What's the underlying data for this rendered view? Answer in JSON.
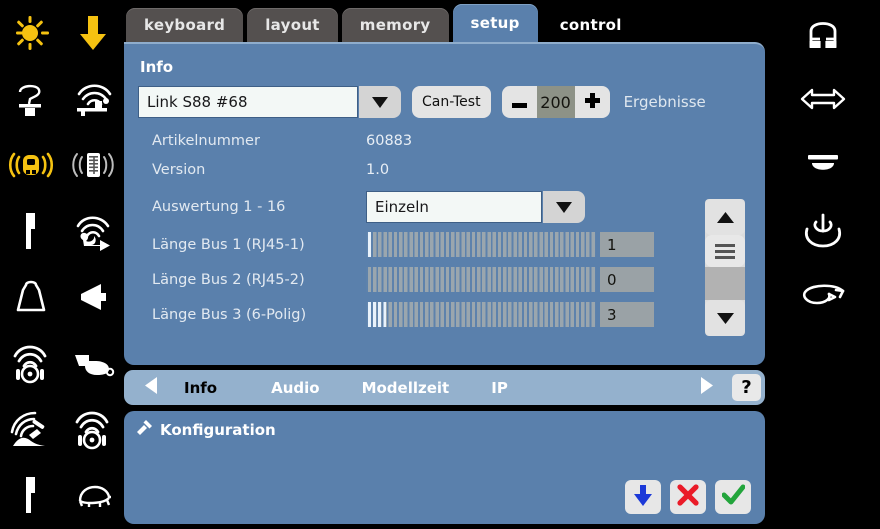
{
  "tabs": [
    {
      "label": "keyboard",
      "active": false
    },
    {
      "label": "layout",
      "active": false
    },
    {
      "label": "memory",
      "active": false
    },
    {
      "label": "setup",
      "active": true
    },
    {
      "label": "control",
      "active": false
    }
  ],
  "panel": {
    "title": "Info",
    "device_select": {
      "value": "Link S88 #68"
    },
    "can_test_label": "Can-Test",
    "stepper": {
      "minus": "–",
      "value": "200",
      "plus": "+"
    },
    "results_label": "Ergebnisse",
    "info_rows": [
      {
        "key": "Artikelnummer",
        "value": "60883"
      },
      {
        "key": "Version",
        "value": "1.0"
      }
    ],
    "auswertung": {
      "key": "Auswertung 1 - 16",
      "value": "Einzeln"
    },
    "bus_rows": [
      {
        "key": "Länge Bus 1 (RJ45-1)",
        "value": "1",
        "fill": 1,
        "segments": 44
      },
      {
        "key": "Länge Bus 2 (RJ45-2)",
        "value": "0",
        "fill": 0,
        "segments": 44
      },
      {
        "key": "Länge Bus 3 (6-Polig)",
        "value": "3",
        "fill": 4,
        "segments": 44
      }
    ]
  },
  "nav": {
    "prev_icon": "triangle-left-icon",
    "next_icon": "triangle-right-icon",
    "items": [
      {
        "label": "Info",
        "selected": true
      },
      {
        "label": "Audio",
        "selected": false
      },
      {
        "label": "Modellzeit",
        "selected": false
      },
      {
        "label": "IP",
        "selected": false
      }
    ],
    "help_label": "?"
  },
  "konfiguration": {
    "title": "Konfiguration",
    "icon": "wrench-icon",
    "actions": [
      {
        "name": "download-button",
        "icon": "down-arrow-icon",
        "color": "#1c39d8"
      },
      {
        "name": "cancel-button",
        "icon": "x-mark-icon",
        "color": "#ea1b28"
      },
      {
        "name": "confirm-button",
        "icon": "check-mark-icon",
        "color": "#23a53c"
      }
    ]
  },
  "sidebar_left": {
    "items": [
      {
        "name": "lamp-icon",
        "color": "#f5c211"
      },
      {
        "name": "down-arrow-icon",
        "color": "#f5c211"
      },
      {
        "name": "smoke-generator-icon",
        "color": "#ffffff"
      },
      {
        "name": "sound-horn-station-icon",
        "color": "#ffffff"
      },
      {
        "name": "locomotive-sound-icon",
        "color": "#f5c211"
      },
      {
        "name": "coach-sound-icon",
        "color": "#ffffff"
      },
      {
        "name": "signal-post-icon",
        "color": "#ffffff"
      },
      {
        "name": "fan-sound-icon",
        "color": "#ffffff"
      },
      {
        "name": "weight-icon",
        "color": "#ffffff"
      },
      {
        "name": "speaker-icon",
        "color": "#ffffff"
      },
      {
        "name": "siren-sound-icon",
        "color": "#ffffff"
      },
      {
        "name": "whistle-icon",
        "color": "#ffffff"
      },
      {
        "name": "coal-shovel-sound-icon",
        "color": "#ffffff"
      },
      {
        "name": "bell-sound-icon",
        "color": "#ffffff"
      },
      {
        "name": "signal-post-2-icon",
        "color": "#ffffff"
      },
      {
        "name": "turtle-slow-icon",
        "color": "#ffffff"
      }
    ]
  },
  "sidebar_right": {
    "items": [
      {
        "name": "magnet-icon",
        "color": "#ffffff"
      },
      {
        "name": "double-arrow-horizontal-icon",
        "color": "#ffffff"
      },
      {
        "name": "pantograph-down-icon",
        "color": "#ffffff"
      },
      {
        "name": "coupler-icon",
        "color": "#ffffff"
      },
      {
        "name": "shunting-loop-icon",
        "color": "#ffffff"
      }
    ]
  },
  "colors": {
    "panel_bg": "#5a80ac",
    "nav_bg": "#94b1cd",
    "tab_inactive": "#54504f",
    "accent_yellow": "#f5c211",
    "app_bg": "#000000"
  }
}
